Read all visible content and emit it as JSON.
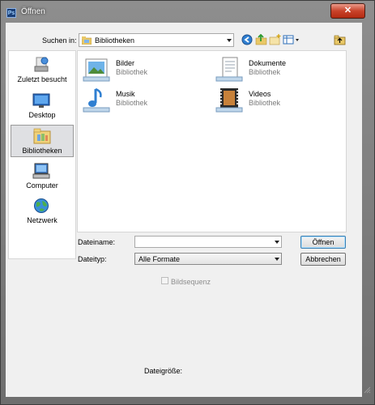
{
  "window": {
    "title": "Öffnen",
    "app_icon_text": "Ps",
    "close_glyph": "✕"
  },
  "lookin": {
    "label": "Suchen in:",
    "value": "Bibliotheken",
    "toolbar_icons": [
      "back-icon",
      "up-folder-icon",
      "new-folder-icon",
      "view-menu-icon"
    ]
  },
  "places": [
    {
      "label": "Zuletzt besucht",
      "icon": "recent-places-icon",
      "selected": false
    },
    {
      "label": "Desktop",
      "icon": "desktop-icon",
      "selected": false
    },
    {
      "label": "Bibliotheken",
      "icon": "libraries-icon",
      "selected": true
    },
    {
      "label": "Computer",
      "icon": "computer-icon",
      "selected": false
    },
    {
      "label": "Netzwerk",
      "icon": "network-icon",
      "selected": false
    }
  ],
  "files": [
    {
      "name": "Bilder",
      "sub": "Bibliothek",
      "icon": "pictures-library-icon"
    },
    {
      "name": "Dokumente",
      "sub": "Bibliothek",
      "icon": "documents-library-icon"
    },
    {
      "name": "Musik",
      "sub": "Bibliothek",
      "icon": "music-library-icon"
    },
    {
      "name": "Videos",
      "sub": "Bibliothek",
      "icon": "videos-library-icon"
    }
  ],
  "form": {
    "filename_label": "Dateiname:",
    "filename_value": "",
    "filetype_label": "Dateityp:",
    "filetype_value": "Alle Formate",
    "open_button": "Öffnen",
    "cancel_button": "Abbrechen",
    "sequence_label": "Bildsequenz",
    "sequence_checked": false,
    "filesize_label": "Dateigröße:"
  }
}
